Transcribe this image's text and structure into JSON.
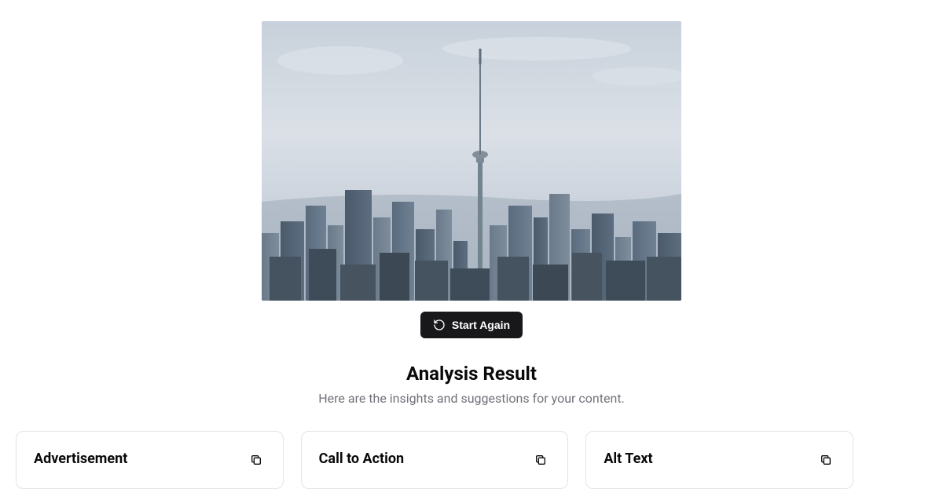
{
  "hero": {
    "image_alt": "City skyline with CN Tower"
  },
  "actions": {
    "start_again_label": "Start Again"
  },
  "result": {
    "title": "Analysis Result",
    "subtitle": "Here are the insights and suggestions for your content."
  },
  "cards": [
    {
      "title": "Advertisement"
    },
    {
      "title": "Call to Action"
    },
    {
      "title": "Alt Text"
    }
  ]
}
